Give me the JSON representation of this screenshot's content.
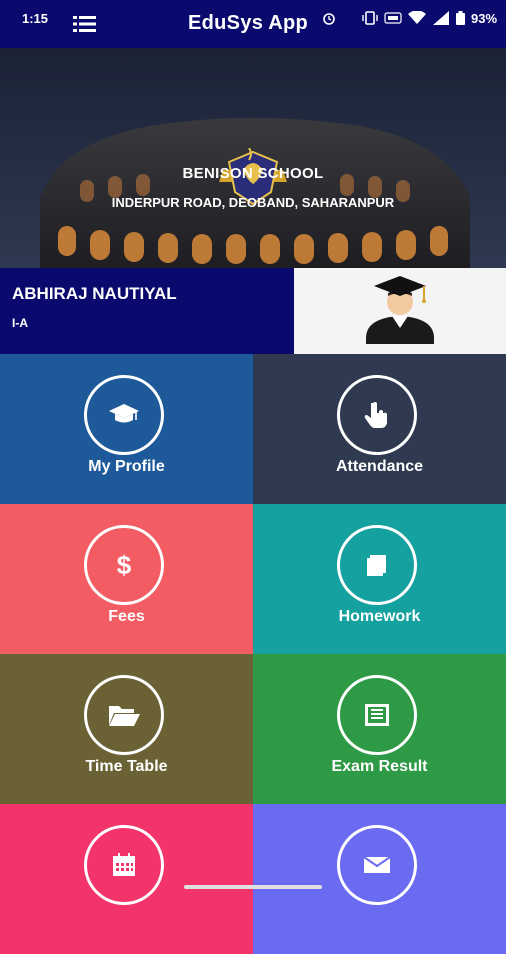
{
  "status_bar": {
    "time": "1:15",
    "battery": "93%"
  },
  "app": {
    "title": "EduSys App"
  },
  "school": {
    "name": "BENISON SCHOOL",
    "address": "INDERPUR ROAD, DEOBAND, SAHARANPUR"
  },
  "student": {
    "name": "ABHIRAJ NAUTIYAL",
    "class": "I-A"
  },
  "tiles": [
    {
      "label": "My Profile",
      "icon": "graduation-cap-icon",
      "color": "#1e5a99"
    },
    {
      "label": "Attendance",
      "icon": "hand-pointer-icon",
      "color": "#2f3a50"
    },
    {
      "label": "Fees",
      "icon": "dollar-icon",
      "color": "#f25c62"
    },
    {
      "label": "Homework",
      "icon": "book-icon",
      "color": "#14a1a0"
    },
    {
      "label": "Time Table",
      "icon": "folder-open-icon",
      "color": "#6a6234"
    },
    {
      "label": "Exam Result",
      "icon": "list-document-icon",
      "color": "#2e9a46"
    },
    {
      "label": "",
      "icon": "calendar-icon",
      "color": "#f2346a"
    },
    {
      "label": "",
      "icon": "envelope-icon",
      "color": "#6b6bf2"
    }
  ]
}
